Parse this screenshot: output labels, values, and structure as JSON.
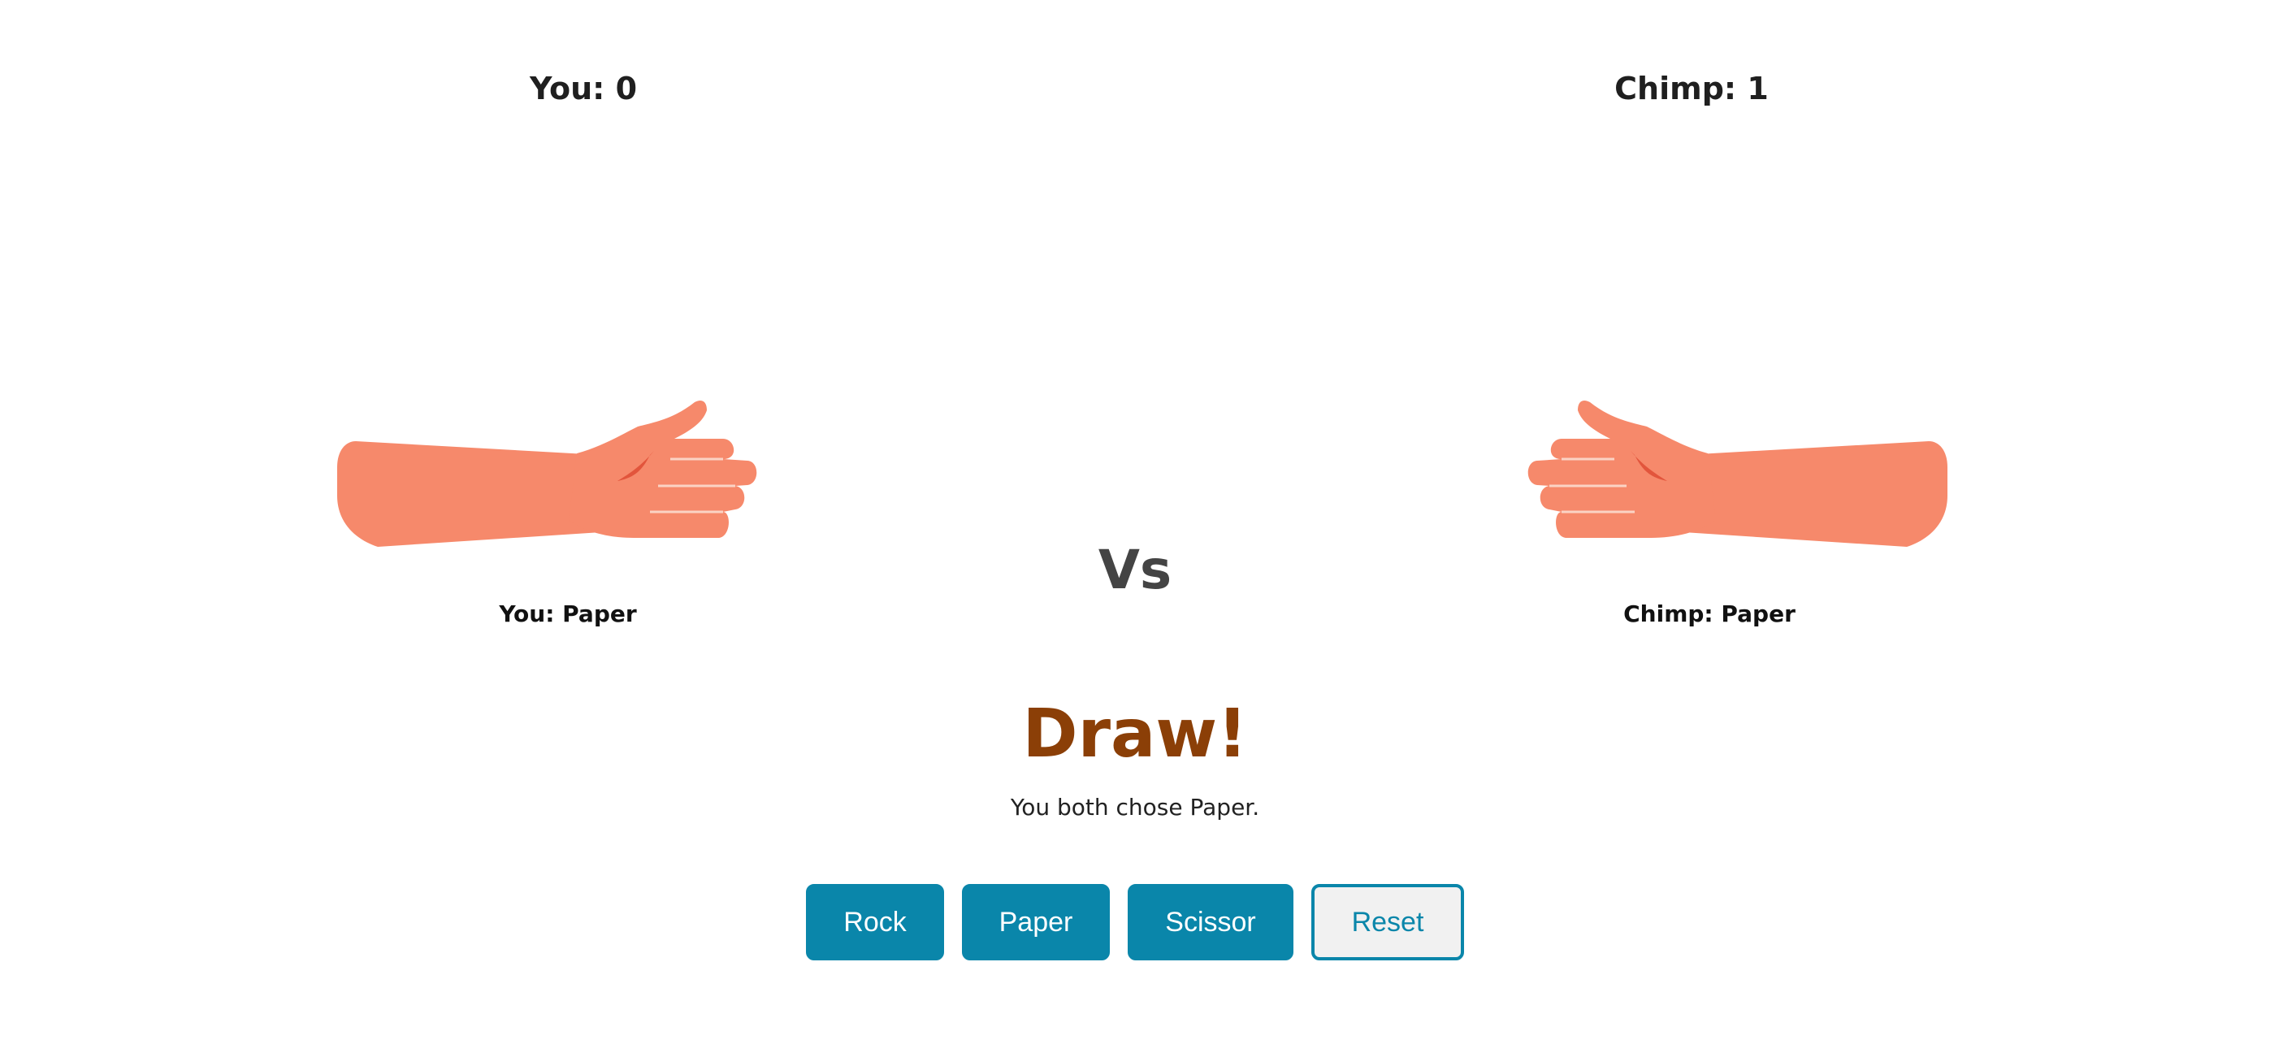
{
  "scoreboard": {
    "you_label": "You: 0",
    "chimp_label": "Chimp: 1"
  },
  "hands": {
    "you_icon": "paper-hand-icon",
    "chimp_icon": "paper-hand-icon",
    "skin_color": "#f6896b",
    "shadow_color": "#e2553c",
    "line_color": "#fbd3c4"
  },
  "choices": {
    "you": "You: Paper",
    "chimp": "Chimp: Paper"
  },
  "vs_label": "Vs",
  "result": {
    "title": "Draw!",
    "detail": "You both chose Paper.",
    "title_color": "#8b3f07"
  },
  "controls": {
    "rock": "Rock",
    "paper": "Paper",
    "scissor": "Scissor",
    "reset": "Reset",
    "accent_color": "#0a86aa"
  }
}
